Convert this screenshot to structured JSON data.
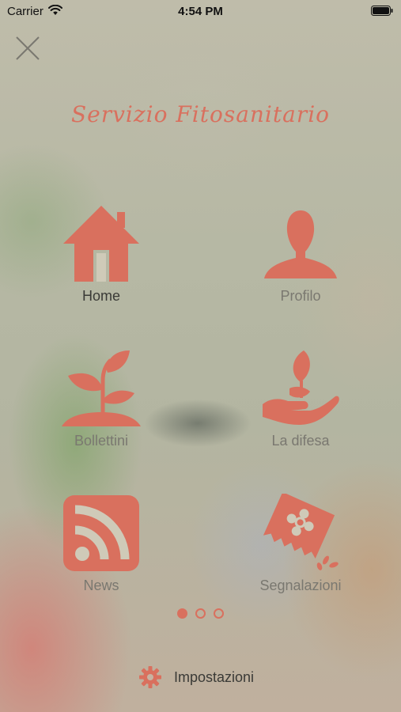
{
  "status_bar": {
    "carrier": "Carrier",
    "time": "4:54 PM"
  },
  "header": {
    "title": "Servizio Fitosanitario"
  },
  "menu": {
    "items": [
      {
        "label": "Home",
        "icon": "home-icon",
        "active": true
      },
      {
        "label": "Profilo",
        "icon": "person-icon",
        "active": false
      },
      {
        "label": "Bollettini",
        "icon": "seedling-icon",
        "active": false
      },
      {
        "label": "La difesa",
        "icon": "hand-plant-icon",
        "active": false
      },
      {
        "label": "News",
        "icon": "rss-icon",
        "active": false
      },
      {
        "label": "Segnalazioni",
        "icon": "seed-packet-icon",
        "active": false
      }
    ]
  },
  "pager": {
    "page_count": 3,
    "current_page": 1
  },
  "footer": {
    "settings_label": "Impostazioni"
  },
  "colors": {
    "accent": "#d9705e",
    "text_active": "#3a3a36",
    "text_inactive": "#7a7870"
  }
}
